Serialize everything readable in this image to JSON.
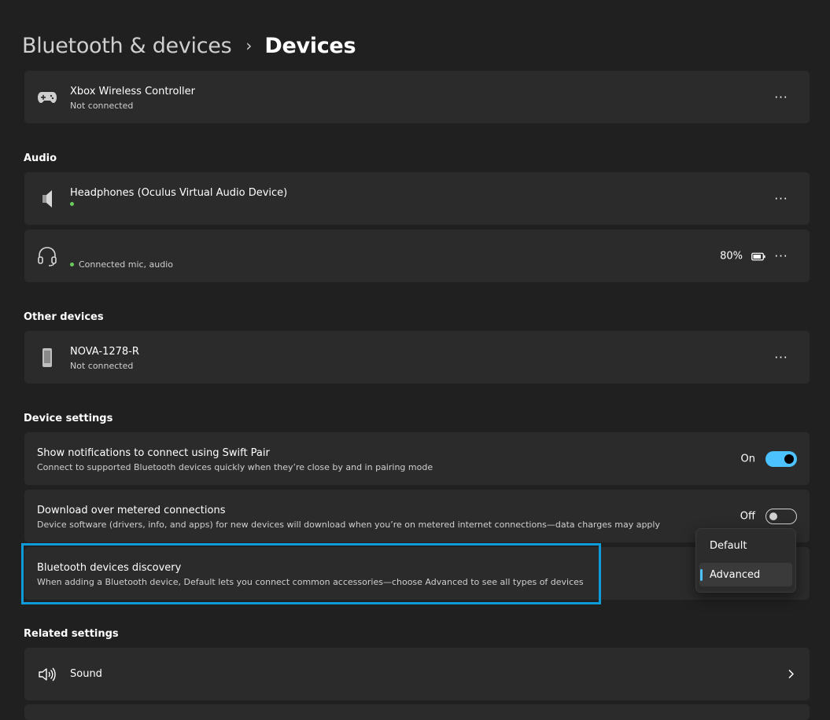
{
  "breadcrumb": {
    "parent": "Bluetooth & devices",
    "separator": "›",
    "current": "Devices"
  },
  "devices": [
    {
      "icon": "gamepad-icon",
      "name": "Xbox Wireless Controller",
      "status": "Not connected",
      "more": "···"
    }
  ],
  "audio": {
    "heading": "Audio",
    "items": [
      {
        "icon": "speaker-icon",
        "name": "Headphones (Oculus Virtual Audio Device)",
        "status": "",
        "status_color": "#6ccb5f",
        "more": "···"
      },
      {
        "icon": "headset-icon",
        "name": "",
        "status": "Connected mic, audio",
        "status_color": "#6ccb5f",
        "battery": "80%",
        "more": "···"
      }
    ]
  },
  "other_devices": {
    "heading": "Other devices",
    "items": [
      {
        "icon": "phone-icon",
        "name": "NOVA-1278-R",
        "status": "Not connected",
        "more": "···"
      }
    ]
  },
  "device_settings": {
    "heading": "Device settings",
    "swift_pair": {
      "title": "Show notifications to connect using Swift Pair",
      "description": "Connect to supported Bluetooth devices quickly when they’re close by and in pairing mode",
      "state_label": "On",
      "state": true
    },
    "metered": {
      "title": "Download over metered connections",
      "description": "Device software (drivers, info, and apps) for new devices will download when you’re on metered internet connections—data charges may apply",
      "state_label": "Off",
      "state": false
    },
    "discovery": {
      "title": "Bluetooth devices discovery",
      "description": "When adding a Bluetooth device, Default lets you connect common accessories—choose Advanced to see all types of devices",
      "options": [
        "Default",
        "Advanced"
      ],
      "selected": "Advanced"
    }
  },
  "related_settings": {
    "heading": "Related settings",
    "items": [
      {
        "icon": "sound-icon",
        "label": "Sound"
      }
    ]
  },
  "colors": {
    "accent": "#4cc2ff",
    "highlight": "#0f9ad9",
    "background": "#202020",
    "card": "#2b2b2b",
    "connected": "#6ccb5f"
  }
}
